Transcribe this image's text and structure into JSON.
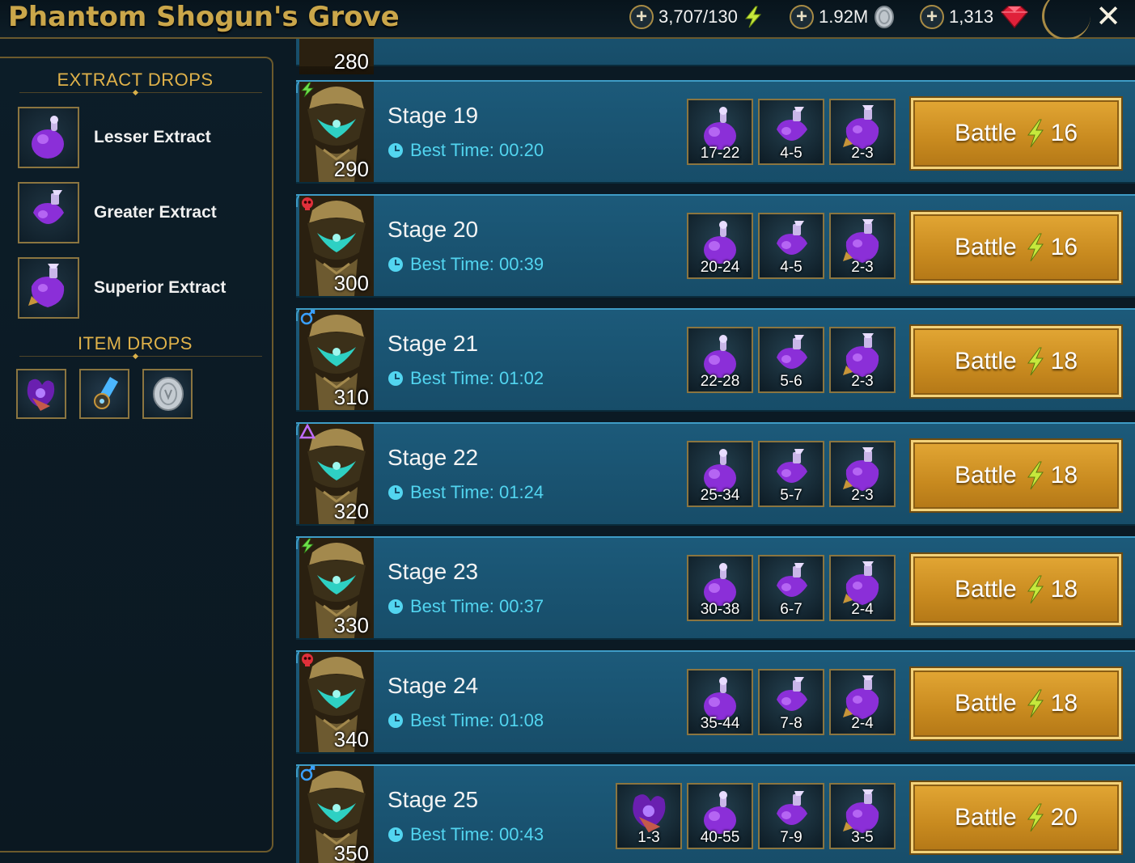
{
  "header": {
    "title": "Phantom Shogun's Grove",
    "energy": "3,707/130",
    "silver": "1.92M",
    "gems": "1,313",
    "energy_icon": "lightning-icon",
    "silver_icon": "silver-coin-icon",
    "gem_icon": "ruby-gem-icon",
    "close_icon": "close-icon"
  },
  "sidebar": {
    "extract_heading": "EXTRACT DROPS",
    "extracts": [
      {
        "label": "Lesser Extract",
        "icon": "lesser-extract-icon"
      },
      {
        "label": "Greater Extract",
        "icon": "greater-extract-icon"
      },
      {
        "label": "Superior Extract",
        "icon": "superior-extract-icon"
      }
    ],
    "item_heading": "ITEM DROPS",
    "items": [
      {
        "icon": "demonic-relic-icon"
      },
      {
        "icon": "blue-talisman-icon"
      },
      {
        "icon": "silver-coin-icon"
      }
    ]
  },
  "partial_stage": {
    "level": "280"
  },
  "stages": [
    {
      "name": "Stage 19",
      "best_time_label": "Best Time:",
      "best_time": "00:20",
      "level": "290",
      "affinity": "force",
      "drops": [
        "17-22",
        "4-5",
        "2-3"
      ],
      "battle_label": "Battle",
      "energy_cost": "16"
    },
    {
      "name": "Stage 20",
      "best_time_label": "Best Time:",
      "best_time": "00:39",
      "level": "300",
      "affinity": "void",
      "drops": [
        "20-24",
        "4-5",
        "2-3"
      ],
      "battle_label": "Battle",
      "energy_cost": "16"
    },
    {
      "name": "Stage 21",
      "best_time_label": "Best Time:",
      "best_time": "01:02",
      "level": "310",
      "affinity": "magic",
      "drops": [
        "22-28",
        "5-6",
        "2-3"
      ],
      "battle_label": "Battle",
      "energy_cost": "18"
    },
    {
      "name": "Stage 22",
      "best_time_label": "Best Time:",
      "best_time": "01:24",
      "level": "320",
      "affinity": "spirit",
      "drops": [
        "25-34",
        "5-7",
        "2-3"
      ],
      "battle_label": "Battle",
      "energy_cost": "18"
    },
    {
      "name": "Stage 23",
      "best_time_label": "Best Time:",
      "best_time": "00:37",
      "level": "330",
      "affinity": "force",
      "drops": [
        "30-38",
        "6-7",
        "2-4"
      ],
      "battle_label": "Battle",
      "energy_cost": "18"
    },
    {
      "name": "Stage 24",
      "best_time_label": "Best Time:",
      "best_time": "01:08",
      "level": "340",
      "affinity": "void",
      "drops": [
        "35-44",
        "7-8",
        "2-4"
      ],
      "battle_label": "Battle",
      "energy_cost": "18"
    },
    {
      "name": "Stage 25",
      "best_time_label": "Best Time:",
      "best_time": "00:43",
      "level": "350",
      "affinity": "magic",
      "relic_drop": "1-3",
      "drops": [
        "40-55",
        "7-9",
        "3-5"
      ],
      "battle_label": "Battle",
      "energy_cost": "20"
    }
  ],
  "colors": {
    "gold": "#caa64a",
    "row_blue": "#1c5a7a",
    "time_cyan": "#52d5f0",
    "button_orange": "#d39528"
  }
}
